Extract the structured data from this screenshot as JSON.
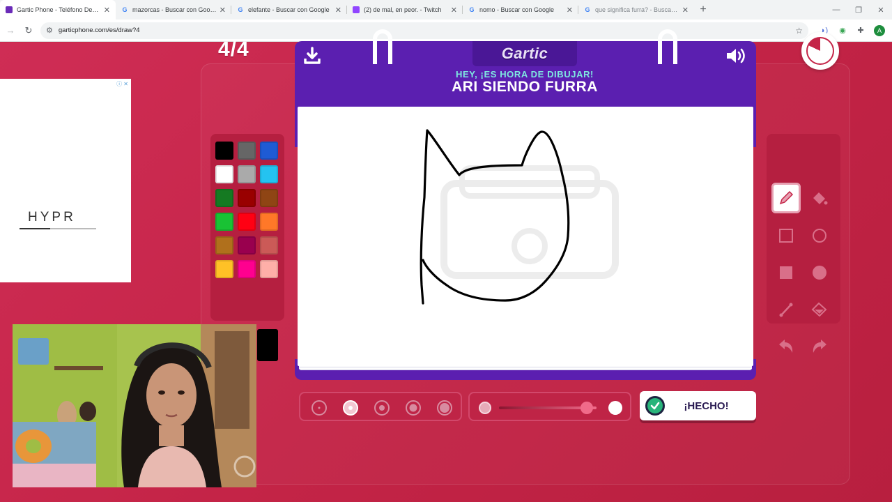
{
  "browser": {
    "tabs": [
      {
        "title": "Gartic Phone - Teléfono Descon",
        "icon": "gartic-favicon",
        "active": true
      },
      {
        "title": "mazorcas - Buscar con Google",
        "icon": "google-favicon",
        "active": false
      },
      {
        "title": "elefante - Buscar con Google",
        "icon": "google-favicon",
        "active": false
      },
      {
        "title": "(2) de mal, en peor. - Twitch",
        "icon": "twitch-favicon",
        "active": false
      },
      {
        "title": "nomo - Buscar con Google",
        "icon": "google-favicon",
        "active": false
      },
      {
        "title": "que significa furra? - Buscar co",
        "icon": "google-favicon",
        "active": false
      }
    ],
    "url": "garticphone.com/es/draw?4"
  },
  "ad": {
    "brand": "HYPR"
  },
  "game": {
    "round": "4/4",
    "logo": "Gartic",
    "prompt_header": "HEY, ¡ES HORA DE DIBUJAR!",
    "prompt": "ARI SIENDO FURRA",
    "timer_remaining_fraction": 0.82,
    "done_label": "¡HECHO!",
    "selected_size_index": 1,
    "opacity_level": 0.9,
    "palette": [
      "#000000",
      "#666666",
      "#1e5bd4",
      "#ffffff",
      "#aaaaaa",
      "#24c3f0",
      "#157a22",
      "#990000",
      "#8f4514",
      "#19c234",
      "#ff0013",
      "#ff7828",
      "#b0701c",
      "#99004e",
      "#cb5a57",
      "#ffc126",
      "#ff008f",
      "#feafa8"
    ],
    "selected_color": "#000000",
    "tools": [
      "pencil",
      "bucket-fill",
      "rectangle-outline",
      "ellipse-outline",
      "rectangle-filled",
      "ellipse-filled",
      "line",
      "eraser-fill",
      "undo",
      "redo"
    ],
    "selected_tool": "pencil"
  }
}
